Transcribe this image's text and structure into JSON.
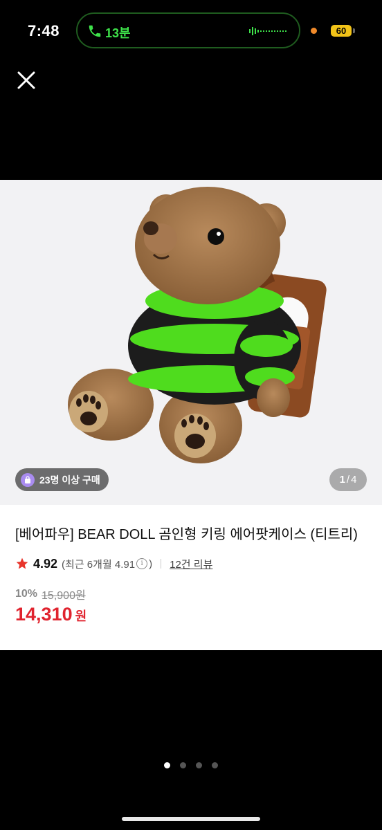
{
  "status_bar": {
    "time": "7:48",
    "call_duration": "13분",
    "battery": "60",
    "call_color": "#3ee24a",
    "battery_color": "#f2c318"
  },
  "header": {
    "close_icon": "close-icon"
  },
  "product": {
    "buyers_badge": "23명 이상 구매",
    "image_index": "1",
    "image_separator": "/",
    "image_total": "4",
    "title": "[베어파우] BEAR DOLL 곰인형 키링 에어팟케이스 (티트리)",
    "rating": "4.92",
    "recent_rating": "(최근 6개월 4.91",
    "recent_close": ")",
    "review_count": "12건 리뷰",
    "discount": "10%",
    "original_price": "15,900원",
    "price": "14,310",
    "currency": "원",
    "price_color": "#e0232e",
    "star_color": "#e8352b"
  },
  "pagination": {
    "total": 4,
    "active": 1
  }
}
